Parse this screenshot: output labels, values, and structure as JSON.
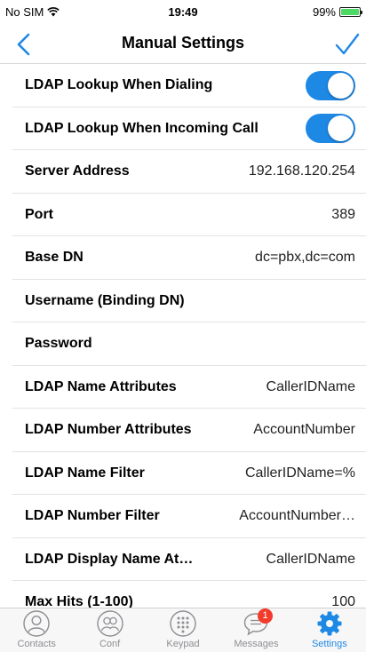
{
  "status_bar": {
    "carrier": "No SIM",
    "time": "19:49",
    "battery": "99%",
    "battery_level": 0.99
  },
  "nav": {
    "title": "Manual Settings"
  },
  "settings": [
    {
      "label": "LDAP Lookup When Dialing",
      "toggle": true
    },
    {
      "label": "LDAP Lookup When Incoming Call",
      "toggle": true
    },
    {
      "label": "Server Address",
      "value": "192.168.120.254"
    },
    {
      "label": "Port",
      "value": "389"
    },
    {
      "label": "Base DN",
      "value": "dc=pbx,dc=com"
    },
    {
      "label": "Username (Binding DN)",
      "value": ""
    },
    {
      "label": "Password",
      "value": ""
    },
    {
      "label": "LDAP Name Attributes",
      "value": "CallerIDName"
    },
    {
      "label": "LDAP Number Attributes",
      "value": "AccountNumber"
    },
    {
      "label": "LDAP Name Filter",
      "value": "CallerIDName=%"
    },
    {
      "label": "LDAP Number Filter",
      "value": "AccountNumber…"
    },
    {
      "label": "LDAP Display Name At…",
      "value": "CallerIDName"
    },
    {
      "label": "Max Hits (1-100)",
      "value": "100"
    }
  ],
  "tabs": [
    {
      "label": "Contacts",
      "icon": "contacts-icon"
    },
    {
      "label": "Conf",
      "icon": "conference-icon"
    },
    {
      "label": "Keypad",
      "icon": "keypad-icon"
    },
    {
      "label": "Messages",
      "icon": "messages-icon",
      "badge": "1"
    },
    {
      "label": "Settings",
      "icon": "settings-gear-icon",
      "active": true
    }
  ],
  "colors": {
    "accent": "#1e88e5",
    "badge": "#f23b2b",
    "battery": "#4cd964"
  }
}
